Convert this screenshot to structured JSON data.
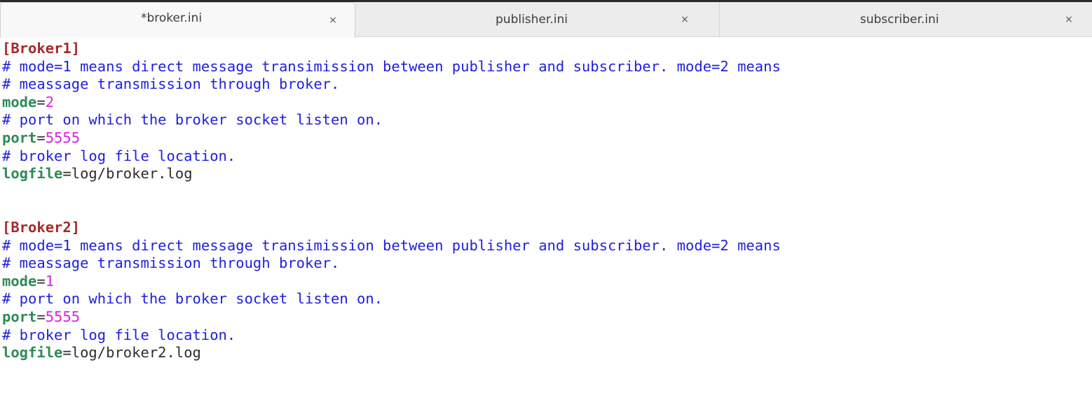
{
  "tabs": [
    {
      "label": "*broker.ini",
      "close": "×",
      "active": true
    },
    {
      "label": "publisher.ini",
      "close": "×",
      "active": false
    },
    {
      "label": "subscriber.ini",
      "close": "×",
      "active": false
    }
  ],
  "editor": {
    "lines": [
      {
        "type": "section",
        "text": "[Broker1]"
      },
      {
        "type": "comment",
        "text": "# mode=1 means direct message transimission between publisher and subscriber. mode=2 means"
      },
      {
        "type": "comment",
        "text": "# meassage transmission through broker."
      },
      {
        "type": "kv",
        "key": "mode",
        "eq": "=",
        "value": "2",
        "value_type": "num"
      },
      {
        "type": "comment",
        "text": "# port on which the broker socket listen on."
      },
      {
        "type": "kv",
        "key": "port",
        "eq": "=",
        "value": "5555",
        "value_type": "num"
      },
      {
        "type": "comment",
        "text": "# broker log file location."
      },
      {
        "type": "kv",
        "key": "logfile",
        "eq": "=",
        "value": "log/broker.log",
        "value_type": "str"
      },
      {
        "type": "blank",
        "text": ""
      },
      {
        "type": "blank",
        "text": ""
      },
      {
        "type": "section",
        "text": "[Broker2]"
      },
      {
        "type": "comment",
        "text": "# mode=1 means direct message transimission between publisher and subscriber. mode=2 means"
      },
      {
        "type": "comment",
        "text": "# meassage transmission through broker."
      },
      {
        "type": "kv",
        "key": "mode",
        "eq": "=",
        "value": "1",
        "value_type": "num"
      },
      {
        "type": "comment",
        "text": "# port on which the broker socket listen on."
      },
      {
        "type": "kv",
        "key": "port",
        "eq": "=",
        "value": "5555",
        "value_type": "num"
      },
      {
        "type": "comment",
        "text": "# broker log file location."
      },
      {
        "type": "kv",
        "key": "logfile",
        "eq": "=",
        "value": "log/broker2.log",
        "value_type": "str"
      }
    ]
  },
  "colors": {
    "comment": "#1f1fe0",
    "section": "#a52a2a",
    "key": "#2e8b57",
    "number": "#e020e0",
    "text": "#2e2e2e"
  }
}
